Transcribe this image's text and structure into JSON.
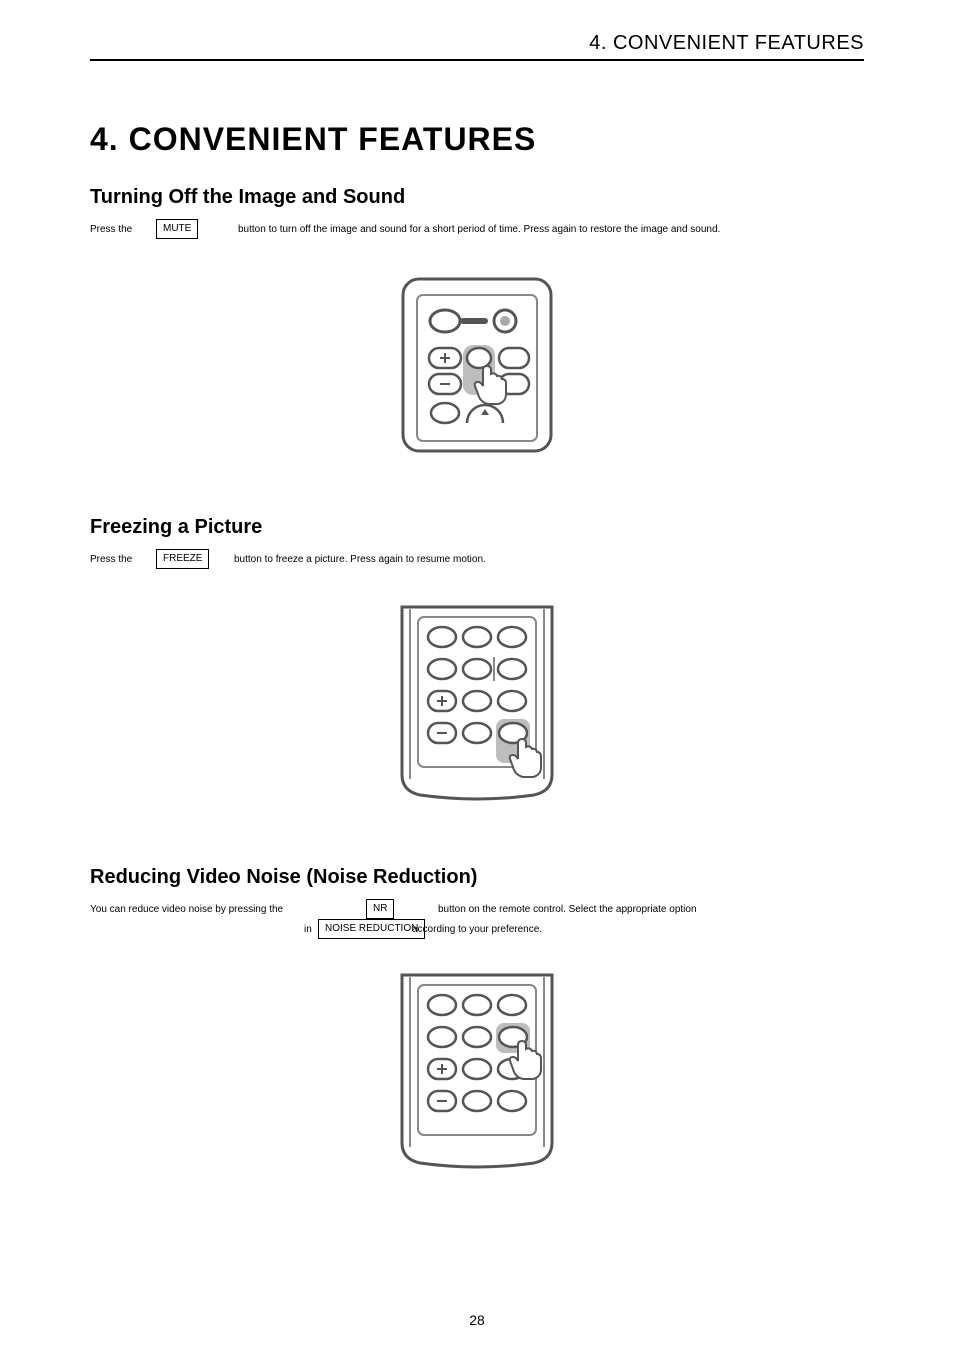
{
  "header": {
    "running": "4. CONVENIENT FEATURES"
  },
  "title": "4. CONVENIENT FEATURES",
  "sections": {
    "s1": {
      "heading": "Turning Off the Image and Sound",
      "desc_pre": "Press the ",
      "btn": "MUTE",
      "desc_post": " button to turn off the image and sound for a short period of time. Press again to restore the image and sound."
    },
    "s2": {
      "heading": "Freezing a Picture",
      "desc_pre": "Press the ",
      "btn": "FREEZE",
      "desc_post": " button to freeze a picture. Press again to resume motion."
    },
    "s3": {
      "heading": "Reducing Video Noise (Noise Reduction)",
      "line1_pre": "You can reduce video noise by pressing the ",
      "btn1": "NR",
      "line1_post": " button on the remote control. Select the appropriate option",
      "line2_pre": "in ",
      "btn2": "NOISE REDUCTION",
      "line2_post": " according to your preference."
    }
  },
  "pageNumber": "28"
}
